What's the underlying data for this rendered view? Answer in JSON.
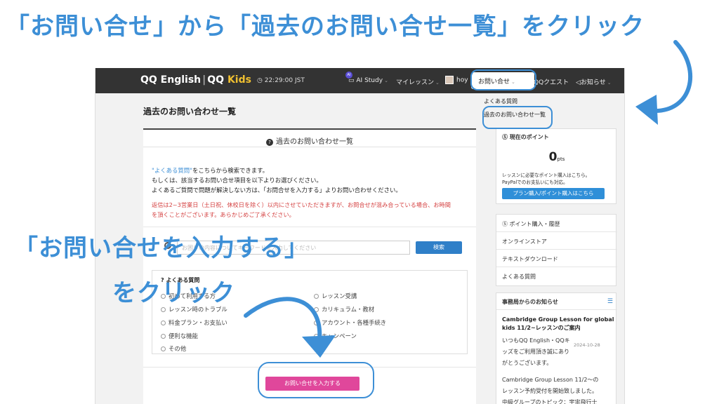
{
  "captions": {
    "top": "「お問い合せ」から「過去のお問い合せ一覧」をクリック",
    "middle_line1": "「お問い合せを入力する」",
    "middle_line2": "をクリック"
  },
  "navbar": {
    "logo_qq_english": "QQ English",
    "logo_qq": "QQ",
    "logo_kids": "Kids",
    "clock": "◷ 22:29:00 JST",
    "ai_badge": "AI",
    "ai_study": "AI Study",
    "my_lessons": "マイレッスン",
    "user": "hoy",
    "inquiry": "お問い合せ",
    "quest": "QQクエスト",
    "news": "お知らせ"
  },
  "dropdown": {
    "faq": "よくある質問",
    "past_inquiries": "過去のお問い合わせ一覧"
  },
  "page": {
    "title": "過去のお問い合わせ一覧",
    "card_header": "過去のお問い合わせ一覧",
    "intro_link": "\"よくある質問\"",
    "intro_1_rest": "をこちらから検索できます。",
    "intro_2": "もしくは、該当するお問い合せ項目を以下よりお選びください。",
    "intro_3": "よくあるご質問で問題が解決しない方は、「お問合せを入力する」よりお問い合わせください。",
    "notice_1": "返信は2~3営業日（土日祝、休校日を除く）以内にさせていただきますが、お問合せが混み合っている場合、お時間",
    "notice_2": "を頂くことがございます。あらかじめご了承ください。",
    "search_placeholder": "お困りの内容についてキーワードを入力してください",
    "search_button": "検索",
    "faq_title": "よくある質問",
    "faq_items": [
      "初めて利用する方",
      "レッスン時のトラブル",
      "料金プラン・お支払い",
      "便利な機能",
      "その他",
      "レッスン受講",
      "カリキュラム・教材",
      "アカウント・各種手続き",
      "キャンペーン"
    ],
    "submit_button": "お問い合せを入力する"
  },
  "sidebar": {
    "points_title": "現在のポイント",
    "points_value": "0",
    "points_unit": "pts",
    "points_text_1": "レッスンに必要なポイント購入はこちら。",
    "points_text_2": "PayPalでのお支払いにも対応。",
    "points_button": "プラン購入/ポイント購入はこちら",
    "links": [
      "ポイント購入・履歴",
      "オンラインストア",
      "テキストダウンロード",
      "よくある質問"
    ],
    "news_head": "事務局からのお知らせ",
    "news_title": "Cambridge Group Lesson for global kids 11/2~レッスンのご案内",
    "news_date": "2024-10-28",
    "news_body": [
      "いつもQQ English・QQキ",
      "ッズをご利用頂き誠にあり",
      "がとうございます。",
      "",
      "Cambridge Group Lesson 11/2〜の",
      "レッスン予約受付を開始致しました。",
      "中級グループのトピック：宇宙飛行士"
    ]
  },
  "colors": {
    "caption_blue": "#3d8fd6",
    "navbar": "#333333",
    "submit_pink": "#e0479b",
    "search_blue": "#2f7fc8",
    "notice_red": "#d43f3f"
  }
}
